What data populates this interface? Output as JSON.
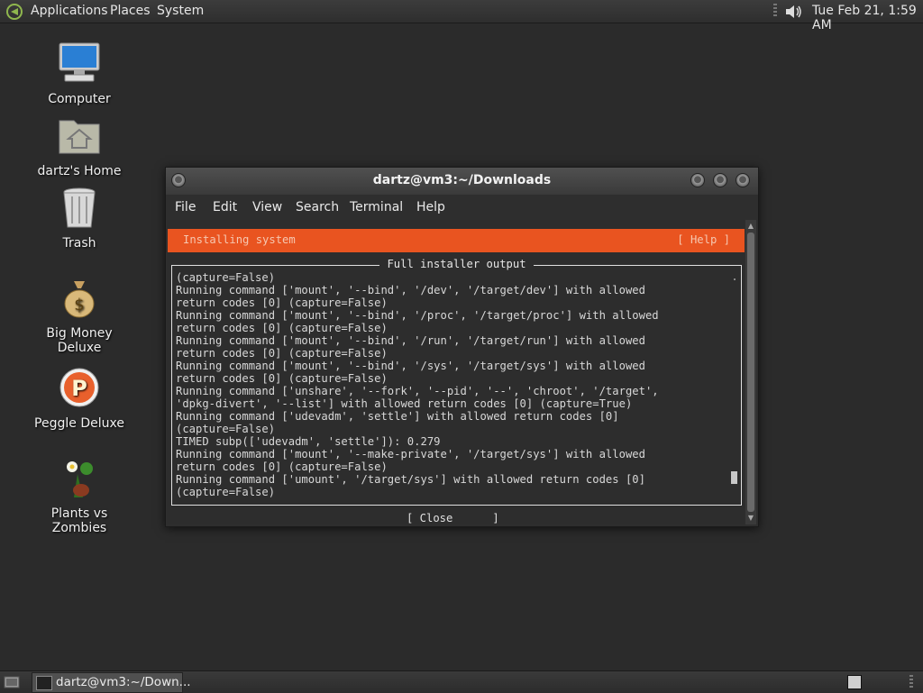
{
  "top_panel": {
    "menus": [
      "Applications",
      "Places",
      "System"
    ],
    "clock": "Tue Feb 21,  1:59 AM"
  },
  "desktop_icons": [
    {
      "label": "Computer"
    },
    {
      "label": "dartz's Home"
    },
    {
      "label": "Trash"
    },
    {
      "label": "Big Money Deluxe"
    },
    {
      "label": "Peggle Deluxe"
    },
    {
      "label": "Plants vs Zombies"
    }
  ],
  "window": {
    "title": "dartz@vm3:~/Downloads",
    "menu": [
      "File",
      "Edit",
      "View",
      "Search",
      "Terminal",
      "Help"
    ]
  },
  "installer": {
    "header_title": "Installing system",
    "help_label": "[ Help ]",
    "output_title": "Full installer output",
    "output_lines": [
      "(capture=False)",
      "Running command ['mount', '--bind', '/dev', '/target/dev'] with allowed",
      "return codes [0] (capture=False)",
      "Running command ['mount', '--bind', '/proc', '/target/proc'] with allowed",
      "return codes [0] (capture=False)",
      "Running command ['mount', '--bind', '/run', '/target/run'] with allowed",
      "return codes [0] (capture=False)",
      "Running command ['mount', '--bind', '/sys', '/target/sys'] with allowed",
      "return codes [0] (capture=False)",
      "Running command ['unshare', '--fork', '--pid', '--', 'chroot', '/target',",
      "'dpkg-divert', '--list'] with allowed return codes [0] (capture=True)",
      "Running command ['udevadm', 'settle'] with allowed return codes [0]",
      "(capture=False)",
      "TIMED subp(['udevadm', 'settle']): 0.279",
      "Running command ['mount', '--make-private', '/target/sys'] with allowed",
      "return codes [0] (capture=False)",
      "Running command ['umount', '/target/sys'] with allowed return codes [0]",
      "(capture=False)"
    ],
    "close_label": "[ Close      ]"
  },
  "bottom_panel": {
    "task_label": "dartz@vm3:~/Down..."
  },
  "colors": {
    "accent": "#e95420",
    "desktop": "#2b2b2b"
  }
}
